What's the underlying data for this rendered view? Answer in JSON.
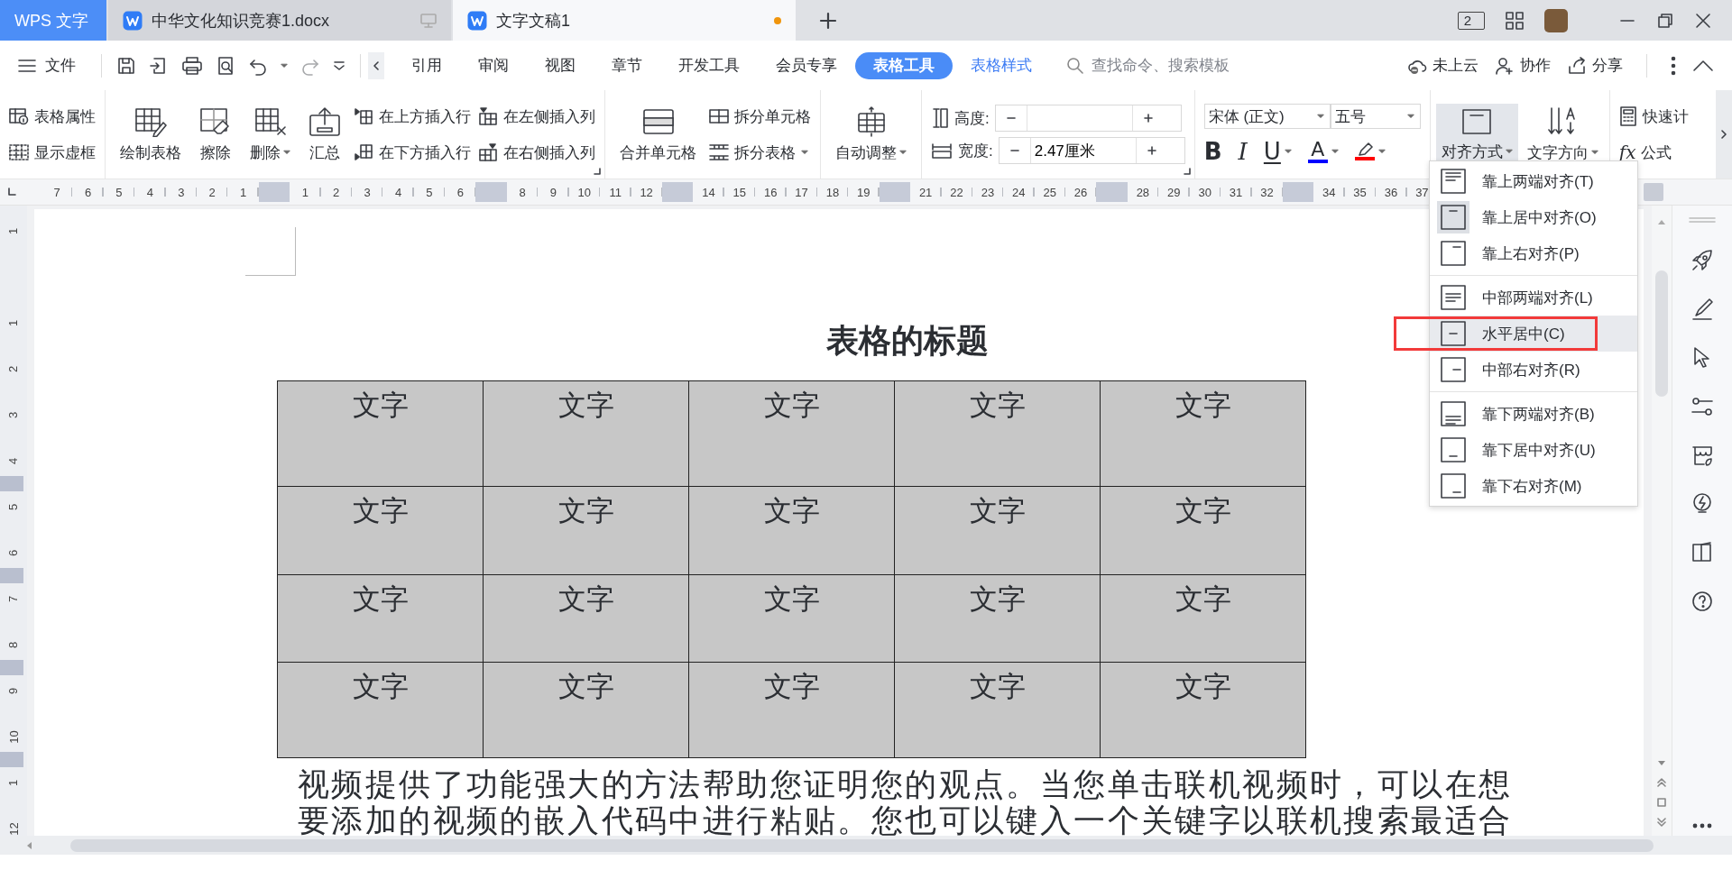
{
  "tabs": [
    {
      "label": "WPS 文字",
      "kind": "app"
    },
    {
      "label": "中华文化知识竞赛1.docx",
      "kind": "doc",
      "selected": false,
      "unsaved": false
    },
    {
      "label": "文字文稿1",
      "kind": "doc",
      "selected": true,
      "unsaved": true
    }
  ],
  "window_count": "2",
  "menu": {
    "file": "文件",
    "items": [
      {
        "label": "引用",
        "kind": "plain",
        "selected": false
      },
      {
        "label": "审阅",
        "kind": "plain",
        "selected": false
      },
      {
        "label": "视图",
        "kind": "plain",
        "selected": false
      },
      {
        "label": "章节",
        "kind": "plain",
        "selected": false
      },
      {
        "label": "开发工具",
        "kind": "plain",
        "selected": false
      },
      {
        "label": "会员专享",
        "kind": "plain",
        "selected": false
      },
      {
        "label": "表格工具",
        "kind": "context",
        "selected": true
      },
      {
        "label": "表格样式",
        "kind": "context",
        "selected": false
      }
    ],
    "search": {
      "placeholder": "查找命令、搜索模板"
    },
    "actions": [
      "未上云",
      "协作",
      "分享"
    ]
  },
  "ribbon": {
    "table_props": [
      "表格属性",
      "显示虚框"
    ],
    "draw_buttons": [
      {
        "label": "绘制表格",
        "dropdown": false
      },
      {
        "label": "擦除",
        "dropdown": false
      },
      {
        "label": "删除",
        "dropdown": true
      },
      {
        "label": "汇总",
        "dropdown": false
      }
    ],
    "insert_buttons": [
      "在上方插入行",
      "在下方插入行",
      "在左侧插入列",
      "在右侧插入列"
    ],
    "merge": "合并单元格",
    "split": [
      {
        "label": "拆分单元格",
        "dropdown": false
      },
      {
        "label": "拆分表格",
        "dropdown": true
      }
    ],
    "autofit": {
      "label": "自动调整",
      "dropdown": true
    },
    "size_fields": [
      {
        "label": "高度:"
      },
      {
        "label": "宽度:",
        "value": "2.47厘米"
      }
    ],
    "font": {
      "name": "宋体 (正文)",
      "size": "五号"
    },
    "format": [
      {
        "kind": "bold",
        "glyph": "B",
        "dropdown": false
      },
      {
        "kind": "italic",
        "glyph": "I",
        "dropdown": false
      },
      {
        "kind": "underline",
        "glyph": "U",
        "dropdown": true
      },
      {
        "kind": "font_color",
        "glyph": "A",
        "dropdown": true,
        "color": "#0000ff"
      },
      {
        "kind": "highlight",
        "dropdown": true,
        "color": "#ff0000"
      }
    ],
    "align": {
      "label": "对齐方式",
      "dropdown": true,
      "pressed": true
    },
    "direction": {
      "label": "文字方向",
      "dropdown": true
    },
    "calc": {
      "label": "快速计"
    },
    "formula": {
      "glyph": "fx",
      "label": "公式"
    }
  },
  "ruler": {
    "h": [
      {
        "kind": "num",
        "text": "7"
      },
      {
        "kind": "num",
        "text": "6"
      },
      {
        "kind": "num",
        "text": "5"
      },
      {
        "kind": "num",
        "text": "4"
      },
      {
        "kind": "num",
        "text": "3"
      },
      {
        "kind": "num",
        "text": "2"
      },
      {
        "kind": "num",
        "text": "1"
      },
      {
        "kind": "mark"
      },
      {
        "kind": "num",
        "text": "1"
      },
      {
        "kind": "num",
        "text": "2"
      },
      {
        "kind": "num",
        "text": "3"
      },
      {
        "kind": "num",
        "text": "4"
      },
      {
        "kind": "num",
        "text": "5"
      },
      {
        "kind": "num",
        "text": "6"
      },
      {
        "kind": "mark"
      },
      {
        "kind": "num",
        "text": "8"
      },
      {
        "kind": "num",
        "text": "9"
      },
      {
        "kind": "num",
        "text": "10"
      },
      {
        "kind": "num",
        "text": "11"
      },
      {
        "kind": "num",
        "text": "12"
      },
      {
        "kind": "mark"
      },
      {
        "kind": "num",
        "text": "14"
      },
      {
        "kind": "num",
        "text": "15"
      },
      {
        "kind": "num",
        "text": "16"
      },
      {
        "kind": "num",
        "text": "17"
      },
      {
        "kind": "num",
        "text": "18"
      },
      {
        "kind": "num",
        "text": "19"
      },
      {
        "kind": "mark"
      },
      {
        "kind": "num",
        "text": "21"
      },
      {
        "kind": "num",
        "text": "22"
      },
      {
        "kind": "num",
        "text": "23"
      },
      {
        "kind": "num",
        "text": "24"
      },
      {
        "kind": "num",
        "text": "25"
      },
      {
        "kind": "num",
        "text": "26"
      },
      {
        "kind": "mark"
      },
      {
        "kind": "num",
        "text": "28"
      },
      {
        "kind": "num",
        "text": "29"
      },
      {
        "kind": "num",
        "text": "30"
      },
      {
        "kind": "num",
        "text": "31"
      },
      {
        "kind": "num",
        "text": "32"
      },
      {
        "kind": "mark"
      },
      {
        "kind": "num",
        "text": "34"
      },
      {
        "kind": "num",
        "text": "35"
      },
      {
        "kind": "num",
        "text": "36"
      },
      {
        "kind": "num",
        "text": "37"
      }
    ],
    "v": [
      {
        "kind": "num",
        "text": "1"
      },
      {
        "kind": "gap"
      },
      {
        "kind": "num",
        "text": "1"
      },
      {
        "kind": "num",
        "text": "2"
      },
      {
        "kind": "num",
        "text": "3"
      },
      {
        "kind": "num",
        "text": "4",
        "boundary": true
      },
      {
        "kind": "num",
        "text": "5"
      },
      {
        "kind": "num",
        "text": "6",
        "boundary": true
      },
      {
        "kind": "num",
        "text": "7"
      },
      {
        "kind": "num",
        "text": "8",
        "boundary": true
      },
      {
        "kind": "num",
        "text": "9"
      },
      {
        "kind": "num",
        "text": "10",
        "boundary": true
      },
      {
        "kind": "num",
        "text": "1"
      },
      {
        "kind": "num",
        "text": "12"
      }
    ]
  },
  "document": {
    "title": "表格的标题",
    "table": {
      "rows": [
        [
          "文字",
          "文字",
          "文字",
          "文字",
          "文字"
        ],
        [
          "文字",
          "文字",
          "文字",
          "文字",
          "文字"
        ],
        [
          "文字",
          "文字",
          "文字",
          "文字",
          "文字"
        ],
        [
          "文字",
          "文字",
          "文字",
          "文字",
          "文字"
        ]
      ]
    },
    "paragraph_lines": [
      "视频提供了功能强大的方法帮助您证明您的观点。当您单击联机视频时，可以在想",
      "要添加的视频的嵌入代码中进行粘贴。您也可以键入一个关键字以联机搜索最适合"
    ]
  },
  "align_menu": {
    "groups": [
      [
        {
          "label": "靠上两端对齐(T)",
          "kind": "top_justify",
          "current": false,
          "hovered": false
        },
        {
          "label": "靠上居中对齐(O)",
          "kind": "top_center",
          "current": true,
          "hovered": false
        },
        {
          "label": "靠上右对齐(P)",
          "kind": "top_right",
          "current": false,
          "hovered": false
        }
      ],
      [
        {
          "label": "中部两端对齐(L)",
          "kind": "middle_justify",
          "current": false,
          "hovered": false
        },
        {
          "label": "水平居中(C)",
          "kind": "middle_center",
          "current": false,
          "hovered": true
        },
        {
          "label": "中部右对齐(R)",
          "kind": "middle_right",
          "current": false,
          "hovered": false
        }
      ],
      [
        {
          "label": "靠下两端对齐(B)",
          "kind": "bottom_justify",
          "current": false,
          "hovered": false
        },
        {
          "label": "靠下居中对齐(U)",
          "kind": "bottom_center",
          "current": false,
          "hovered": false
        },
        {
          "label": "靠下右对齐(M)",
          "kind": "bottom_right",
          "current": false,
          "hovered": false
        }
      ]
    ]
  }
}
